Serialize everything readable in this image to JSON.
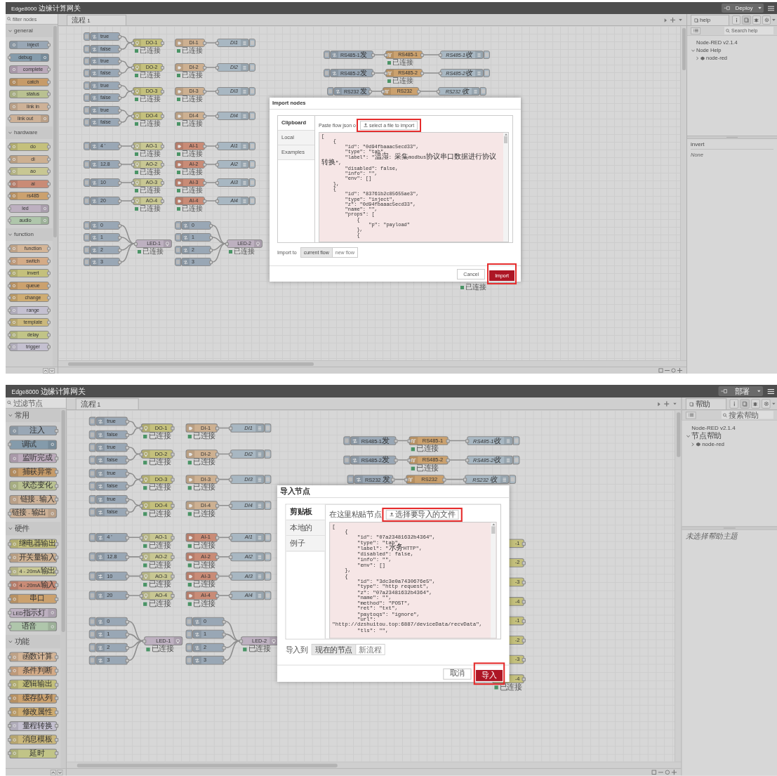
{
  "screens": [
    {
      "header": {
        "title": "Edge8000 边缘计算网关",
        "deploy": "Deploy"
      },
      "palette": {
        "placeholder": "filter nodes",
        "categories": [
          {
            "name": "general",
            "expanded": true,
            "items": [
              {
                "label": "inject",
                "kind": "source",
                "color": "#99a7b5"
              },
              {
                "label": "debug",
                "kind": "sink",
                "color": "#849bab"
              },
              {
                "label": "complete",
                "kind": "source",
                "color": "#bbaabb"
              },
              {
                "label": "catch",
                "kind": "source",
                "color": "#c69b69"
              },
              {
                "label": "status",
                "kind": "source",
                "color": "#b9c191"
              },
              {
                "label": "link in",
                "kind": "source",
                "color": "#cdb197"
              },
              {
                "label": "link out",
                "kind": "sink",
                "color": "#cdb197"
              }
            ]
          },
          {
            "name": "hardware",
            "expanded": true,
            "items": [
              {
                "label": "do",
                "kind": "through",
                "color": "#c4c07c"
              },
              {
                "label": "di",
                "kind": "through",
                "color": "#cdb091"
              },
              {
                "label": "ao",
                "kind": "through",
                "color": "#c8c793"
              },
              {
                "label": "ai",
                "kind": "through",
                "color": "#c98b76"
              },
              {
                "label": "rs485",
                "kind": "through",
                "color": "#cba16e"
              },
              {
                "label": "led",
                "kind": "sink",
                "color": "#bdb0c0"
              },
              {
                "label": "audio",
                "kind": "sink",
                "color": "#afc6ab"
              }
            ]
          },
          {
            "name": "function",
            "expanded": true,
            "items": [
              {
                "label": "function",
                "kind": "through",
                "color": "#d4b597"
              },
              {
                "label": "switch",
                "kind": "through",
                "color": "#d4ab87"
              },
              {
                "label": "invert",
                "kind": "through",
                "color": "#c4c07c"
              },
              {
                "label": "queue",
                "kind": "through",
                "color": "#cba16e"
              },
              {
                "label": "change",
                "kind": "through",
                "color": "#ceac72"
              },
              {
                "label": "range",
                "kind": "through",
                "color": "#c4c0d0"
              },
              {
                "label": "template",
                "kind": "through",
                "color": "#cbb87c"
              },
              {
                "label": "delay",
                "kind": "through",
                "color": "#c1c487"
              },
              {
                "label": "trigger",
                "kind": "through",
                "color": "#c4c0d0"
              }
            ]
          }
        ]
      },
      "workspace": {
        "tab": "流程 1",
        "nodes": [
          {
            "kind": "inject",
            "label": "true"
          },
          {
            "kind": "inject",
            "label": "false"
          },
          {
            "kind": "inject",
            "label": "true"
          },
          {
            "kind": "inject",
            "label": "false"
          },
          {
            "kind": "inject",
            "label": "true"
          },
          {
            "kind": "inject",
            "label": "false"
          },
          {
            "kind": "inject",
            "label": "true"
          },
          {
            "kind": "inject",
            "label": "false"
          },
          {
            "kind": "do",
            "label": "DO-1",
            "status": "已连接"
          },
          {
            "kind": "do",
            "label": "DO-2",
            "status": "已连接"
          },
          {
            "kind": "do",
            "label": "DO-3",
            "status": "已连接"
          },
          {
            "kind": "do",
            "label": "DO-4",
            "status": "已连接"
          },
          {
            "kind": "di",
            "label": "DI-1",
            "status": "已连接"
          },
          {
            "kind": "di",
            "label": "DI-2",
            "status": "已连接"
          },
          {
            "kind": "di",
            "label": "DI-3",
            "status": "已连接"
          },
          {
            "kind": "di",
            "label": "DI-4",
            "status": "已连接"
          },
          {
            "kind": "debug",
            "label": "DI1"
          },
          {
            "kind": "debug",
            "label": "DI2"
          },
          {
            "kind": "debug",
            "label": "DI3"
          },
          {
            "kind": "debug",
            "label": "DI4"
          },
          {
            "kind": "inject",
            "label": "4 '"
          },
          {
            "kind": "inject",
            "label": "12.8"
          },
          {
            "kind": "inject",
            "label": "10"
          },
          {
            "kind": "inject",
            "label": "20"
          },
          {
            "kind": "ao",
            "label": "AO-1",
            "status": "已连接"
          },
          {
            "kind": "ao",
            "label": "AO-2",
            "status": "已连接"
          },
          {
            "kind": "ao",
            "label": "AO-3",
            "status": "已连接"
          },
          {
            "kind": "ao",
            "label": "AO-4",
            "status": "已连接"
          },
          {
            "kind": "ai",
            "label": "AI-1",
            "status": "已连接"
          },
          {
            "kind": "ai",
            "label": "AI-2",
            "status": "已连接"
          },
          {
            "kind": "ai",
            "label": "AI-3",
            "status": "已连接"
          },
          {
            "kind": "ai",
            "label": "AI-4",
            "status": "已连接"
          },
          {
            "kind": "debug",
            "label": "AI1"
          },
          {
            "kind": "debug",
            "label": "AI2"
          },
          {
            "kind": "debug",
            "label": "AI3"
          },
          {
            "kind": "debug",
            "label": "AI4"
          },
          {
            "kind": "inject",
            "label": "0"
          },
          {
            "kind": "inject",
            "label": "1"
          },
          {
            "kind": "inject",
            "label": "2"
          },
          {
            "kind": "inject",
            "label": "3"
          },
          {
            "kind": "led",
            "label": "LED-1",
            "status": "已连接"
          },
          {
            "kind": "inject",
            "label": "0"
          },
          {
            "kind": "inject",
            "label": "1"
          },
          {
            "kind": "inject",
            "label": "2"
          },
          {
            "kind": "inject",
            "label": "3"
          },
          {
            "kind": "led",
            "label": "LED-2",
            "status": "已连接"
          },
          {
            "kind": "inject",
            "label": "RS485-1发"
          },
          {
            "kind": "rs485",
            "label": "RS485-1",
            "status": "已连接"
          },
          {
            "kind": "debug",
            "label": "RS485-1收"
          },
          {
            "kind": "inject",
            "label": "RS485-2发"
          },
          {
            "kind": "rs485",
            "label": "RS485-2",
            "status": "已连接"
          },
          {
            "kind": "debug",
            "label": "RS485-2收"
          },
          {
            "kind": "inject",
            "label": "RS232 发"
          },
          {
            "kind": "rs485",
            "label": "RS232"
          },
          {
            "kind": "debug",
            "label": "RS232 收"
          },
          {
            "status": "已连接"
          }
        ]
      },
      "dialog": {
        "title": "Import nodes",
        "tabs": [
          {
            "label": "Clipboard",
            "selected": true
          },
          {
            "label": "Local",
            "selected": false
          },
          {
            "label": "Examples",
            "selected": false
          }
        ],
        "paste_label": "Paste flow json o",
        "file_button": "select a file to import",
        "code": [
          "[",
          "    {",
          "        \"id\": \"0d94fbaaac5ecd33\",",
          "        \"type\": \"tab\",",
          "        \"label\": \"温湿: 采集modbus协议串口数据进行协议",
          "转换\",",
          "        \"disabled\": false,",
          "        \"info\": \"\",",
          "        \"env\": []",
          "    },",
          "    {",
          "        \"id\": \"83761b2c85655ae3\",",
          "        \"type\": \"inject\",",
          "        \"z\": \"0d94fbaaac5ecd33\",",
          "        \"name\": \"\",",
          "        \"props\": [",
          "            {",
          "                \"p\": \"payload\"",
          "            },",
          "            {"
        ],
        "import_to_label": "Import to",
        "targets": [
          {
            "label": "current flow",
            "selected": true
          },
          {
            "label": "new flow",
            "selected": false
          }
        ],
        "cancel": "Cancel",
        "confirm": "Import"
      },
      "sidebar": {
        "tab": "help",
        "search_placeholder": "Search help",
        "tree": [
          {
            "label": "Node-RED v2.1.4"
          },
          {
            "label": "Node Help",
            "expanded": true,
            "children": [
              {
                "label": "node-red",
                "expanded": false
              }
            ]
          }
        ],
        "topic_title": "invert",
        "topic_body": "None"
      }
    },
    {
      "header": {
        "title": "Edge8000 边缘计算网关",
        "deploy": "部署"
      },
      "palette": {
        "placeholder": "过滤节点",
        "categories": [
          {
            "name": "常用",
            "expanded": true,
            "items": [
              {
                "label": "注入",
                "kind": "source",
                "color": "#99a7b5"
              },
              {
                "label": "调试",
                "kind": "sink",
                "color": "#849bab"
              },
              {
                "label": "监听完成",
                "kind": "source",
                "color": "#bbaabb"
              },
              {
                "label": "捕获异常",
                "kind": "source",
                "color": "#c69b69"
              },
              {
                "label": "状态变化",
                "kind": "source",
                "color": "#b9c191"
              },
              {
                "label": "链接 - 输入",
                "kind": "source",
                "color": "#cdb197"
              },
              {
                "label": "链接 - 输出",
                "kind": "sink",
                "color": "#cdb197"
              }
            ]
          },
          {
            "name": "硬件",
            "expanded": true,
            "items": [
              {
                "label": "继电器输出",
                "kind": "through",
                "color": "#c4c07c"
              },
              {
                "label": "开关量输入",
                "kind": "through",
                "color": "#cdb091"
              },
              {
                "label": "4 - 20mA输出",
                "kind": "through",
                "color": "#c8c793"
              },
              {
                "label": "4 - 20mA输入",
                "kind": "through",
                "color": "#c98b76"
              },
              {
                "label": "串口",
                "kind": "through",
                "color": "#cba16e"
              },
              {
                "label": "LED指示灯",
                "kind": "sink",
                "color": "#bdb0c0"
              },
              {
                "label": "语音",
                "kind": "sink",
                "color": "#afc6ab"
              }
            ]
          },
          {
            "name": "功能",
            "expanded": true,
            "items": [
              {
                "label": "函数计算",
                "kind": "through",
                "color": "#d4b597"
              },
              {
                "label": "条件判断",
                "kind": "through",
                "color": "#d4ab87"
              },
              {
                "label": "逻辑输出",
                "kind": "through",
                "color": "#c4c07c"
              },
              {
                "label": "缓存队列",
                "kind": "through",
                "color": "#cba16e"
              },
              {
                "label": "修改属性",
                "kind": "through",
                "color": "#ceac72"
              },
              {
                "label": "量程转换",
                "kind": "through",
                "color": "#c4c0d0"
              },
              {
                "label": "消息模板",
                "kind": "through",
                "color": "#cbb87c"
              },
              {
                "label": "延时",
                "kind": "through",
                "color": "#c1c487"
              }
            ]
          }
        ]
      },
      "workspace": {
        "tab": "流程 1",
        "nodes": [
          {
            "kind": "inject",
            "label": "true"
          },
          {
            "kind": "inject",
            "label": "false"
          },
          {
            "kind": "inject",
            "label": "true"
          },
          {
            "kind": "inject",
            "label": "false"
          },
          {
            "kind": "inject",
            "label": "true"
          },
          {
            "kind": "inject",
            "label": "false"
          },
          {
            "kind": "inject",
            "label": "true"
          },
          {
            "kind": "inject",
            "label": "false"
          },
          {
            "kind": "do",
            "label": "DO-1",
            "status": "已连接"
          },
          {
            "kind": "do",
            "label": "DO-2",
            "status": "已连接"
          },
          {
            "kind": "do",
            "label": "DO-3",
            "status": "已连接"
          },
          {
            "kind": "do",
            "label": "DO-4",
            "status": "已连接"
          },
          {
            "kind": "di",
            "label": "DI-1",
            "status": "已连接"
          },
          {
            "kind": "di",
            "label": "DI-2",
            "status": "已连接"
          },
          {
            "kind": "di",
            "label": "DI-3",
            "status": "已连接"
          },
          {
            "kind": "di",
            "label": "DI-4",
            "status": "已连接"
          },
          {
            "kind": "debug",
            "label": "DI1"
          },
          {
            "kind": "debug",
            "label": "DI2"
          },
          {
            "kind": "debug",
            "label": "DI3"
          },
          {
            "kind": "debug",
            "label": "DI4"
          },
          {
            "kind": "inject",
            "label": "4 '"
          },
          {
            "kind": "inject",
            "label": "12.8"
          },
          {
            "kind": "inject",
            "label": "10"
          },
          {
            "kind": "inject",
            "label": "20"
          },
          {
            "kind": "ao",
            "label": "AO-1",
            "status": "已连接"
          },
          {
            "kind": "ao",
            "label": "AO-2",
            "status": "已连接"
          },
          {
            "kind": "ao",
            "label": "AO-3",
            "status": "已连接"
          },
          {
            "kind": "ao",
            "label": "AO-4",
            "status": "已连接"
          },
          {
            "kind": "ai",
            "label": "AI-1",
            "status": "已连接"
          },
          {
            "kind": "ai",
            "label": "AI-2",
            "status": "已连接"
          },
          {
            "kind": "ai",
            "label": "AI-3",
            "status": "已连接"
          },
          {
            "kind": "ai",
            "label": "AI-4",
            "status": "已连接"
          },
          {
            "kind": "debug",
            "label": "AI1"
          },
          {
            "kind": "debug",
            "label": "AI2"
          },
          {
            "kind": "debug",
            "label": "AI3"
          },
          {
            "kind": "debug",
            "label": "AI4"
          },
          {
            "kind": "inject",
            "label": "0"
          },
          {
            "kind": "inject",
            "label": "1"
          },
          {
            "kind": "inject",
            "label": "2"
          },
          {
            "kind": "inject",
            "label": "3"
          },
          {
            "kind": "led",
            "label": "LED-1",
            "status": "已连接"
          },
          {
            "kind": "inject",
            "label": "0"
          },
          {
            "kind": "inject",
            "label": "1"
          },
          {
            "kind": "inject",
            "label": "2"
          },
          {
            "kind": "inject",
            "label": "3"
          },
          {
            "kind": "led",
            "label": "LED-2",
            "status": "已连接"
          },
          {
            "kind": "inject",
            "label": "RS485-1发"
          },
          {
            "kind": "rs485",
            "label": "RS485-1",
            "status": "已连接"
          },
          {
            "kind": "debug",
            "label": "RS485-1收"
          },
          {
            "kind": "inject",
            "label": "RS485-2发"
          },
          {
            "kind": "rs485",
            "label": "RS485-2",
            "status": "已连接"
          },
          {
            "kind": "debug",
            "label": "RS485-2收"
          },
          {
            "kind": "inject",
            "label": "RS232 发"
          },
          {
            "kind": "rs485",
            "label": "RS232"
          },
          {
            "kind": "debug",
            "label": "RS232 收"
          },
          {
            "kind": "partial",
            "label": "-1"
          },
          {
            "kind": "partial",
            "label": "-2"
          },
          {
            "kind": "partial",
            "label": "-3"
          },
          {
            "kind": "partial",
            "label": "-4"
          },
          {
            "kind": "partial",
            "label": "-1"
          },
          {
            "kind": "partial",
            "label": "-2"
          },
          {
            "kind": "partial",
            "label": "-3"
          },
          {
            "kind": "partial",
            "label": "-4",
            "status": "已连接"
          }
        ]
      },
      "dialog": {
        "title": "导入节点",
        "tabs": [
          {
            "label": "剪贴板",
            "selected": true
          },
          {
            "label": "本地的",
            "selected": false
          },
          {
            "label": "例子",
            "selected": false
          }
        ],
        "paste_label": "在这里粘贴节点",
        "file_button": "选择要导入的文件",
        "code": [
          "[",
          "    {",
          "        \"id\": \"07a23481632b4364\",",
          "        \"type\": \"tab\",",
          "        \"label\": \"水务HTTP\",",
          "        \"disabled\": false,",
          "        \"info\": \"\",",
          "        \"env\": []",
          "    },",
          "    {",
          "        \"id\": \"3dc3e0a7430676e5\",",
          "        \"type\": \"http request\",",
          "        \"z\": \"07a23481632b4364\",",
          "        \"name\": \"\",",
          "        \"method\": \"POST\",",
          "        \"ret\": \"txt\",",
          "        \"paytoqs\": \"ignore\",",
          "        \"url\":",
          "\"http://dzshuitou.top:6887/deviceData/recvData\",",
          "        \"tls\": \"\","
        ],
        "import_to_label": "导入到",
        "targets": [
          {
            "label": "现在的节点",
            "selected": true
          },
          {
            "label": "新流程",
            "selected": false
          }
        ],
        "cancel": "取消",
        "confirm": "导入"
      },
      "sidebar": {
        "tab": "帮助",
        "search_placeholder": "搜索帮助",
        "tree": [
          {
            "label": "Node-RED v2.1.4"
          },
          {
            "label": "节点帮助",
            "expanded": true,
            "children": [
              {
                "label": "node-red",
                "expanded": false
              }
            ]
          }
        ],
        "topic_body": "未选择帮助主题"
      }
    }
  ]
}
